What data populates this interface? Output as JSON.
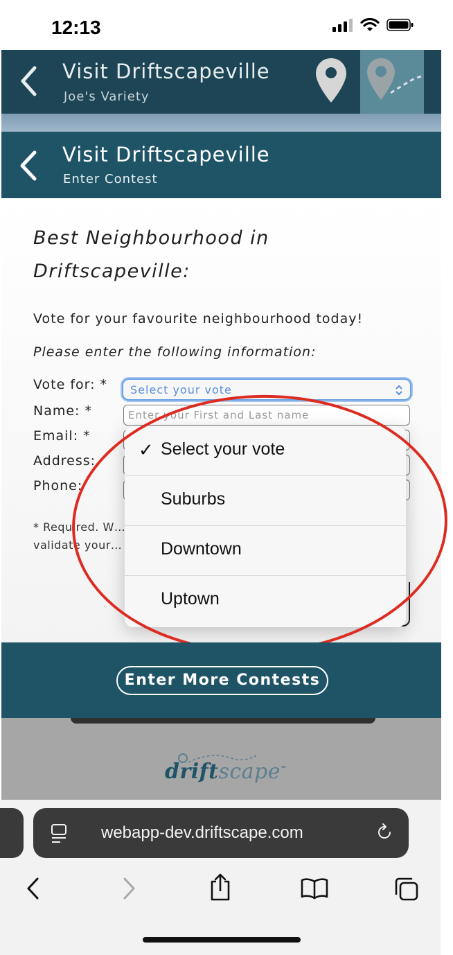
{
  "status_bar": {
    "time": "12:13"
  },
  "app_header_back": {
    "title": "Visit Driftscapeville",
    "subtitle": "Joe's Variety"
  },
  "app_header": {
    "title": "Visit Driftscapeville",
    "subtitle": "Enter Contest"
  },
  "contest": {
    "heading": "Best Neighbourhood in Driftscapeville:",
    "intro": "Vote for your favourite neighbourhood today!",
    "instructions": "Please enter the following information:",
    "fields": {
      "vote_label": "Vote for: *",
      "vote_value": "Select your vote",
      "name_label": "Name: *",
      "name_placeholder": "Enter your First and Last name",
      "email_label": "Email: *",
      "address_label": "Address:",
      "phone_label": "Phone:"
    },
    "note": "* Required. W… validate your…"
  },
  "dropdown": {
    "selected_mark": "✓",
    "options": [
      "Select your vote",
      "Suburbs",
      "Downtown",
      "Uptown"
    ]
  },
  "footer": {
    "more_button": "Enter More Contests",
    "logo_part1": "drift",
    "logo_part2": "scape",
    "logo_tm": "™"
  },
  "browser": {
    "url": "webapp-dev.driftscape.com"
  },
  "colors": {
    "header": "#1f5467",
    "accent_blue": "#6da2e6",
    "annotation": "#dc2c22"
  }
}
